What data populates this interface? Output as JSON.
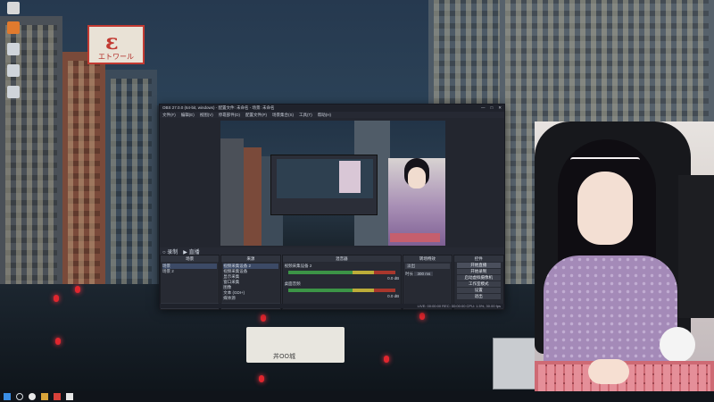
{
  "desktop": {
    "icons": [
      {
        "label": "",
        "icon": "app-shortcut-icon",
        "color": "#d8d8d8"
      },
      {
        "label": "",
        "icon": "app-shortcut-icon",
        "color": "#e07a2e"
      },
      {
        "label": "",
        "icon": "app-shortcut-icon",
        "color": "#cfd4da"
      },
      {
        "label": "",
        "icon": "app-shortcut-icon",
        "color": "#cfd4da"
      },
      {
        "label": "",
        "icon": "app-shortcut-icon",
        "color": "#cfd4da"
      }
    ],
    "notes": [
      "",
      "",
      ""
    ],
    "sign_text": "エトワール",
    "sign_glyph": "ε",
    "boat_label": "丼OO城"
  },
  "obs": {
    "title": "OBS 27.0.0 (64-bit, windows) - 配置文件: 未命名 - 场景: 未命名",
    "window_buttons": [
      "—",
      "□",
      "✕"
    ],
    "menu": [
      "文件(F)",
      "编辑(E)",
      "视图(V)",
      "停靠部件(D)",
      "配置文件(P)",
      "场景集合(S)",
      "工具(T)",
      "帮助(H)"
    ],
    "preview_toolbar": [
      "○ 录制",
      "▶ 直播"
    ],
    "docks": {
      "scenes": {
        "title": "场景",
        "items": [
          "场景",
          "场景 2"
        ]
      },
      "sources": {
        "title": "来源",
        "items": [
          "视频采集设备 2",
          "视频采集设备",
          "显示采集",
          "窗口采集",
          "图像",
          "文本 (GDI+)",
          "媒体源"
        ]
      },
      "mixer": {
        "title": "混音器",
        "channels": [
          {
            "name": "视频采集设备 2",
            "db": "0.0 dB"
          },
          {
            "name": "桌面音频",
            "db": "0.0 dB"
          }
        ]
      },
      "transitions": {
        "title": "转场特效",
        "value": "淡出",
        "duration_label": "时长",
        "duration": "300 ms"
      },
      "controls": {
        "title": "控件",
        "buttons": [
          "开始直播",
          "开始录制",
          "启动虚拟摄像机",
          "工作室模式",
          "设置",
          "退出"
        ]
      }
    },
    "status": "LIVE: 00:00:00  REC: 00:00:00  CPU: 1.5%, 30.00 fps"
  },
  "taskbar": {
    "icons": [
      {
        "name": "windows-start-icon",
        "color": "#3b8ee6"
      },
      {
        "name": "search-icon",
        "color": "#d7dbe0"
      },
      {
        "name": "obs-icon",
        "color": "#e8e8e8"
      },
      {
        "name": "app-icon",
        "color": "#d9a43a"
      },
      {
        "name": "app-icon",
        "color": "#d8413a"
      },
      {
        "name": "app-icon",
        "color": "#e6e6e6"
      }
    ],
    "clock": ""
  }
}
